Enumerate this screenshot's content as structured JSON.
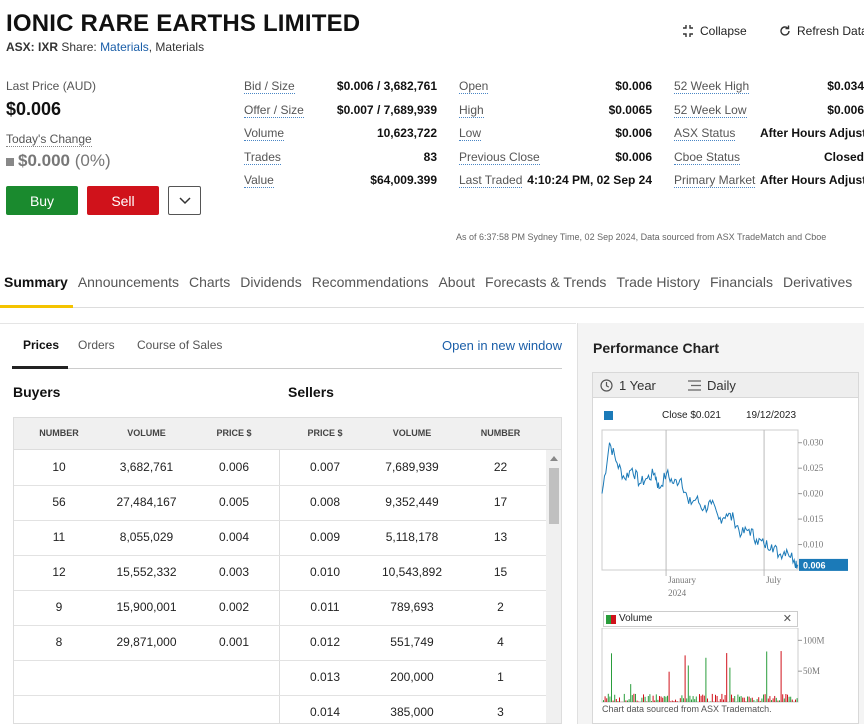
{
  "header": {
    "company_name": "IONIC RARE EARTHS LIMITED",
    "exchange_code": "ASX: IXR",
    "share_label": "Share:",
    "sector_link": "Materials",
    "sector_text": "Materials",
    "collapse_label": "Collapse",
    "refresh_label": "Refresh Data"
  },
  "quote": {
    "last_price_label": "Last Price (AUD)",
    "last_price": "$0.006",
    "todays_change_label": "Today's Change",
    "todays_change": "$0.000",
    "todays_change_pct": "(0%)",
    "buy_label": "Buy",
    "sell_label": "Sell"
  },
  "stats": {
    "col1": [
      {
        "label": "Bid / Size",
        "value": "$0.006 / 3,682,761"
      },
      {
        "label": "Offer / Size",
        "value": "$0.007 / 7,689,939"
      },
      {
        "label": "Volume",
        "value": "10,623,722"
      },
      {
        "label": "Trades",
        "value": "83"
      },
      {
        "label": "Value",
        "value": "$64,009.399"
      }
    ],
    "col2": [
      {
        "label": "Open",
        "value": "$0.006"
      },
      {
        "label": "High",
        "value": "$0.0065"
      },
      {
        "label": "Low",
        "value": "$0.006"
      },
      {
        "label": "Previous Close",
        "value": "$0.006"
      },
      {
        "label": "Last Traded",
        "value": "4:10:24 PM, 02 Sep 24"
      }
    ],
    "col3": [
      {
        "label": "52 Week High",
        "value": "$0.034"
      },
      {
        "label": "52 Week Low",
        "value": "$0.006"
      },
      {
        "label": "ASX Status",
        "value": "After Hours Adjust"
      },
      {
        "label": "Cboe Status",
        "value": "Closed"
      },
      {
        "label": "Primary Market",
        "value": "After Hours Adjust"
      }
    ],
    "as_of": "As of 6:37:58 PM Sydney Time, 02 Sep 2024, Data sourced from ASX TradeMatch and Cboe"
  },
  "nav": {
    "tabs": [
      "Summary",
      "Announcements",
      "Charts",
      "Dividends",
      "Recommendations",
      "About",
      "Forecasts & Trends",
      "Trade History",
      "Financials",
      "Derivatives"
    ]
  },
  "prices": {
    "subtabs": [
      "Prices",
      "Orders",
      "Course of Sales"
    ],
    "open_new_window": "Open in new window",
    "buyers_label": "Buyers",
    "sellers_label": "Sellers",
    "columns": [
      "NUMBER",
      "VOLUME",
      "PRICE $",
      "PRICE $",
      "VOLUME",
      "NUMBER"
    ],
    "buyers": [
      {
        "number": "10",
        "volume": "3,682,761",
        "price": "0.006"
      },
      {
        "number": "56",
        "volume": "27,484,167",
        "price": "0.005"
      },
      {
        "number": "11",
        "volume": "8,055,029",
        "price": "0.004"
      },
      {
        "number": "12",
        "volume": "15,552,332",
        "price": "0.003"
      },
      {
        "number": "9",
        "volume": "15,900,001",
        "price": "0.002"
      },
      {
        "number": "8",
        "volume": "29,871,000",
        "price": "0.001"
      }
    ],
    "sellers": [
      {
        "price": "0.007",
        "volume": "7,689,939",
        "number": "22"
      },
      {
        "price": "0.008",
        "volume": "9,352,449",
        "number": "17"
      },
      {
        "price": "0.009",
        "volume": "5,118,178",
        "number": "13"
      },
      {
        "price": "0.010",
        "volume": "10,543,892",
        "number": "15"
      },
      {
        "price": "0.011",
        "volume": "789,693",
        "number": "2"
      },
      {
        "price": "0.012",
        "volume": "551,749",
        "number": "4"
      },
      {
        "price": "0.013",
        "volume": "200,000",
        "number": "1"
      },
      {
        "price": "0.014",
        "volume": "385,000",
        "number": "3"
      }
    ]
  },
  "performance": {
    "title": "Performance Chart",
    "period_label": "1 Year",
    "interval_label": "Daily",
    "legend_close": "Close $0.021",
    "legend_date": "19/12/2023",
    "volume_label": "Volume",
    "footnote": "Chart data sourced from ASX Tradematch.",
    "colors": {
      "price_line": "#1b7ab8",
      "badge": "#1b7ab8",
      "vol_up": "#2a9d3c",
      "vol_down": "#d0121b"
    }
  },
  "chart_data": [
    {
      "type": "line",
      "x_ticks": [
        "January 2024",
        "July"
      ],
      "y_ticks": [
        "0.030",
        "0.025",
        "0.020",
        "0.015",
        "0.010"
      ],
      "ylim": [
        0.005,
        0.0325
      ],
      "current_value_label": "0.006",
      "x": [
        "2023-09-04",
        "2023-09-18",
        "2023-10-02",
        "2023-10-16",
        "2023-10-30",
        "2023-11-13",
        "2023-11-27",
        "2023-12-11",
        "2023-12-19",
        "2024-01-02",
        "2024-01-15",
        "2024-01-29",
        "2024-02-12",
        "2024-02-26",
        "2024-03-11",
        "2024-03-25",
        "2024-04-08",
        "2024-04-22",
        "2024-05-06",
        "2024-05-20",
        "2024-06-03",
        "2024-06-17",
        "2024-07-01",
        "2024-07-15",
        "2024-07-29",
        "2024-08-12",
        "2024-08-26",
        "2024-09-02"
      ],
      "values": [
        0.02,
        0.03,
        0.026,
        0.023,
        0.025,
        0.022,
        0.023,
        0.024,
        0.021,
        0.024,
        0.022,
        0.023,
        0.018,
        0.019,
        0.017,
        0.018,
        0.015,
        0.016,
        0.015,
        0.012,
        0.013,
        0.011,
        0.01,
        0.01,
        0.008,
        0.009,
        0.007,
        0.006
      ]
    },
    {
      "type": "bar",
      "y_ticks": [
        "100M",
        "50M"
      ],
      "ylim": [
        0,
        120
      ]
    }
  ]
}
